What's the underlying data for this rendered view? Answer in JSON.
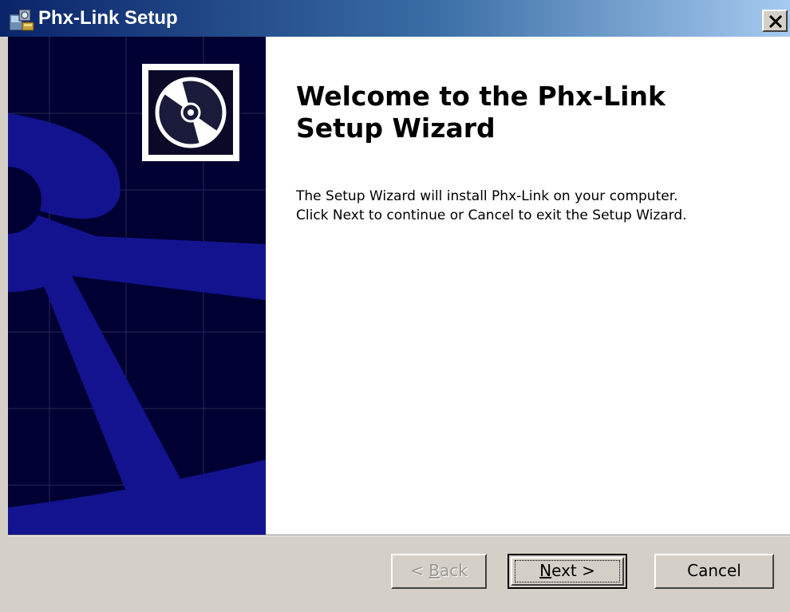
{
  "window": {
    "title": "Phx-Link Setup"
  },
  "welcome": {
    "title": "Welcome to the Phx-Link Setup Wizard",
    "line1": "The Setup Wizard will install Phx-Link on your computer.",
    "line2": "Click Next to continue or Cancel to exit the Setup Wizard."
  },
  "buttons": {
    "back_mnemonic": "B",
    "back_rest": "ack",
    "back_prefix": "< ",
    "next_mnemonic": "N",
    "next_rest": "ext >",
    "cancel": "Cancel"
  },
  "colors": {
    "banner_dark": "#000033",
    "banner_blue": "#13138f",
    "title_gradient_start": "#0a246a",
    "title_gradient_end": "#a6caf0",
    "dialog_face": "#d4d0c8"
  },
  "icons": {
    "title_icon": "setup-installer-icon",
    "banner_icon": "cd-disc-icon",
    "close": "close-icon"
  }
}
